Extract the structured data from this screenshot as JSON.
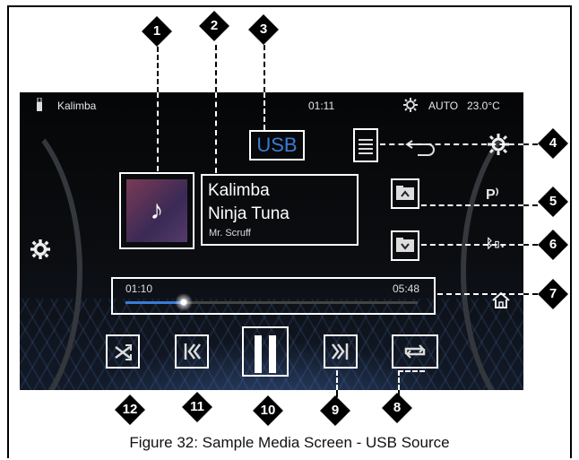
{
  "status_bar": {
    "track": "Kalimba",
    "time": "01:11",
    "climate_mode": "AUTO",
    "temperature": "23.0°C"
  },
  "source_label": "USB",
  "now_playing": {
    "title": "Kalimba",
    "album": "Ninja Tuna",
    "artist": "Mr. Scruff"
  },
  "progress": {
    "elapsed": "01:10",
    "total": "05:48",
    "fraction": 0.2
  },
  "callouts": [
    "1",
    "2",
    "3",
    "4",
    "5",
    "6",
    "7",
    "8",
    "9",
    "10",
    "11",
    "12"
  ],
  "caption": "Figure 32: Sample Media Screen - USB Source",
  "colors": {
    "accent": "#3a7bd5",
    "screen_bg": "#0b0d10",
    "box_outline": "#ffffff"
  }
}
